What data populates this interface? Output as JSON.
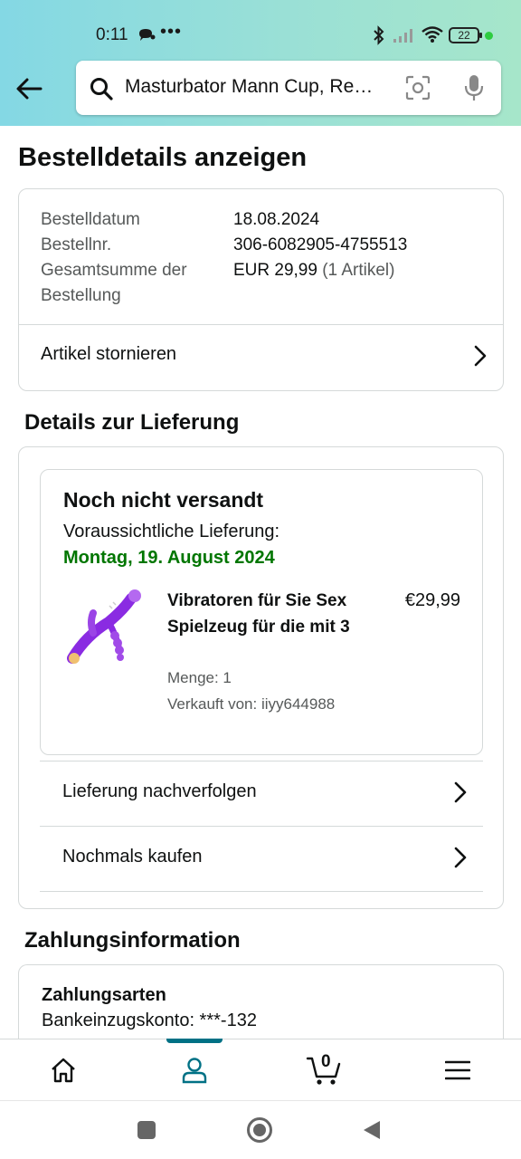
{
  "status_bar": {
    "time": "0:11",
    "battery": "22"
  },
  "search": {
    "query": "Masturbator Mann Cup, Re…"
  },
  "page": {
    "title": "Bestelldetails anzeigen"
  },
  "order_summary": {
    "rows": [
      {
        "label": "Bestelldatum",
        "value": "18.08.2024"
      },
      {
        "label": "Bestellnr.",
        "value": "306-6082905-4755513"
      }
    ],
    "total_label_line1": "Gesamtsumme der",
    "total_label_line2": "Bestellung",
    "total_value": "EUR 29,99",
    "total_items": "(1 Artikel)",
    "cancel_label": "Artikel stornieren"
  },
  "delivery": {
    "section_title": "Details zur Lieferung",
    "status": "Noch nicht versandt",
    "eta_label": "Voraussichtliche Lieferung:",
    "eta_date": "Montag, 19. August 2024",
    "item": {
      "title": "Vibratoren für Sie Sex Spielzeug für die mit 3",
      "price": "€29,99",
      "quantity": "Menge: 1",
      "seller": "Verkauft von: iiyy644988"
    },
    "track_label": "Lieferung nachverfolgen",
    "buy_again_label": "Nochmals kaufen"
  },
  "payment": {
    "section_title": "Zahlungsinformation",
    "methods_title": "Zahlungsarten",
    "method_line": "Bankeinzugskonto: ***-132"
  },
  "tabbar": {
    "cart_count": "0",
    "active_color": "#007185"
  },
  "colors": {
    "eta": "#007600",
    "accent": "#007185",
    "border": "#d5d9d9"
  }
}
